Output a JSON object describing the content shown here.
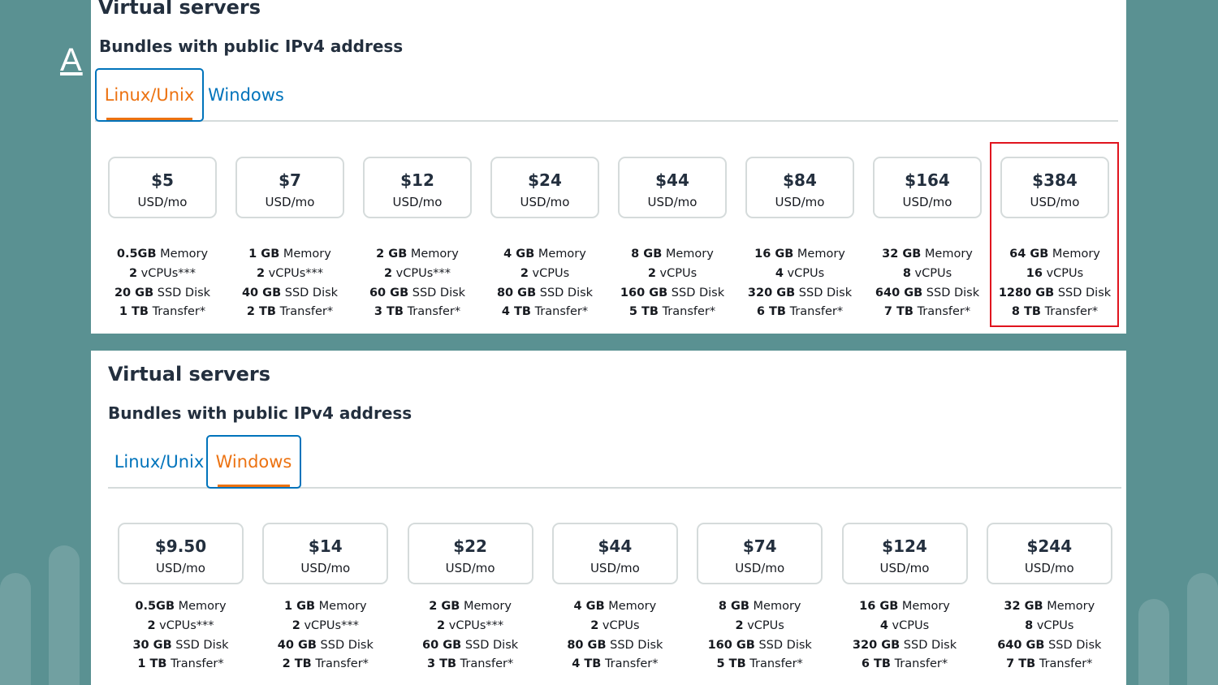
{
  "background": {
    "title_fragment": "A"
  },
  "linux_panel": {
    "title": "Virtual servers",
    "subtitle": "Bundles with public IPv4 address",
    "tabs": [
      {
        "label": "Linux/Unix",
        "active": true
      },
      {
        "label": "Windows",
        "active": false
      }
    ],
    "plans": [
      {
        "price": "$5",
        "unit": "USD/mo",
        "memory_val": "0.5GB",
        "memory_label": "Memory",
        "vcpu_val": "2",
        "vcpu_label": "vCPUs***",
        "disk_val": "20 GB",
        "disk_label": "SSD Disk",
        "transfer_val": "1 TB",
        "transfer_label": "Transfer*"
      },
      {
        "price": "$7",
        "unit": "USD/mo",
        "memory_val": "1 GB",
        "memory_label": "Memory",
        "vcpu_val": "2",
        "vcpu_label": "vCPUs***",
        "disk_val": "40 GB",
        "disk_label": "SSD Disk",
        "transfer_val": "2 TB",
        "transfer_label": "Transfer*"
      },
      {
        "price": "$12",
        "unit": "USD/mo",
        "memory_val": "2 GB",
        "memory_label": "Memory",
        "vcpu_val": "2",
        "vcpu_label": "vCPUs***",
        "disk_val": "60 GB",
        "disk_label": "SSD Disk",
        "transfer_val": "3 TB",
        "transfer_label": "Transfer*"
      },
      {
        "price": "$24",
        "unit": "USD/mo",
        "memory_val": "4 GB",
        "memory_label": "Memory",
        "vcpu_val": "2",
        "vcpu_label": "vCPUs",
        "disk_val": "80 GB",
        "disk_label": "SSD Disk",
        "transfer_val": "4 TB",
        "transfer_label": "Transfer*"
      },
      {
        "price": "$44",
        "unit": "USD/mo",
        "memory_val": "8 GB",
        "memory_label": "Memory",
        "vcpu_val": "2",
        "vcpu_label": "vCPUs",
        "disk_val": "160 GB",
        "disk_label": "SSD Disk",
        "transfer_val": "5 TB",
        "transfer_label": "Transfer*"
      },
      {
        "price": "$84",
        "unit": "USD/mo",
        "memory_val": "16 GB",
        "memory_label": "Memory",
        "vcpu_val": "4",
        "vcpu_label": "vCPUs",
        "disk_val": "320 GB",
        "disk_label": "SSD Disk",
        "transfer_val": "6 TB",
        "transfer_label": "Transfer*"
      },
      {
        "price": "$164",
        "unit": "USD/mo",
        "memory_val": "32 GB",
        "memory_label": "Memory",
        "vcpu_val": "8",
        "vcpu_label": "vCPUs",
        "disk_val": "640 GB",
        "disk_label": "SSD Disk",
        "transfer_val": "7 TB",
        "transfer_label": "Transfer*"
      },
      {
        "price": "$384",
        "unit": "USD/mo",
        "memory_val": "64 GB",
        "memory_label": "Memory",
        "vcpu_val": "16",
        "vcpu_label": "vCPUs",
        "disk_val": "1280 GB",
        "disk_label": "SSD Disk",
        "transfer_val": "8 TB",
        "transfer_label": "Transfer*",
        "highlighted": true
      }
    ]
  },
  "windows_panel": {
    "title": "Virtual servers",
    "subtitle": "Bundles with public IPv4 address",
    "tabs": [
      {
        "label": "Linux/Unix",
        "active": false
      },
      {
        "label": "Windows",
        "active": true
      }
    ],
    "plans": [
      {
        "price": "$9.50",
        "unit": "USD/mo",
        "memory_val": "0.5GB",
        "memory_label": "Memory",
        "vcpu_val": "2",
        "vcpu_label": "vCPUs***",
        "disk_val": "30 GB",
        "disk_label": "SSD Disk",
        "transfer_val": "1 TB",
        "transfer_label": "Transfer*"
      },
      {
        "price": "$14",
        "unit": "USD/mo",
        "memory_val": "1 GB",
        "memory_label": "Memory",
        "vcpu_val": "2",
        "vcpu_label": "vCPUs***",
        "disk_val": "40 GB",
        "disk_label": "SSD Disk",
        "transfer_val": "2 TB",
        "transfer_label": "Transfer*"
      },
      {
        "price": "$22",
        "unit": "USD/mo",
        "memory_val": "2 GB",
        "memory_label": "Memory",
        "vcpu_val": "2",
        "vcpu_label": "vCPUs***",
        "disk_val": "60 GB",
        "disk_label": "SSD Disk",
        "transfer_val": "3 TB",
        "transfer_label": "Transfer*"
      },
      {
        "price": "$44",
        "unit": "USD/mo",
        "memory_val": "4 GB",
        "memory_label": "Memory",
        "vcpu_val": "2",
        "vcpu_label": "vCPUs",
        "disk_val": "80 GB",
        "disk_label": "SSD Disk",
        "transfer_val": "4 TB",
        "transfer_label": "Transfer*"
      },
      {
        "price": "$74",
        "unit": "USD/mo",
        "memory_val": "8 GB",
        "memory_label": "Memory",
        "vcpu_val": "2",
        "vcpu_label": "vCPUs",
        "disk_val": "160 GB",
        "disk_label": "SSD Disk",
        "transfer_val": "5 TB",
        "transfer_label": "Transfer*"
      },
      {
        "price": "$124",
        "unit": "USD/mo",
        "memory_val": "16 GB",
        "memory_label": "Memory",
        "vcpu_val": "4",
        "vcpu_label": "vCPUs",
        "disk_val": "320 GB",
        "disk_label": "SSD Disk",
        "transfer_val": "6 TB",
        "transfer_label": "Transfer*"
      },
      {
        "price": "$244",
        "unit": "USD/mo",
        "memory_val": "32 GB",
        "memory_label": "Memory",
        "vcpu_val": "8",
        "vcpu_label": "vCPUs",
        "disk_val": "640 GB",
        "disk_label": "SSD Disk",
        "transfer_val": "7 TB",
        "transfer_label": "Transfer*"
      }
    ]
  },
  "colors": {
    "background": "#5a9192",
    "active_tab": "#ec7211",
    "link": "#0073bb",
    "highlight_border": "#e0141e"
  }
}
